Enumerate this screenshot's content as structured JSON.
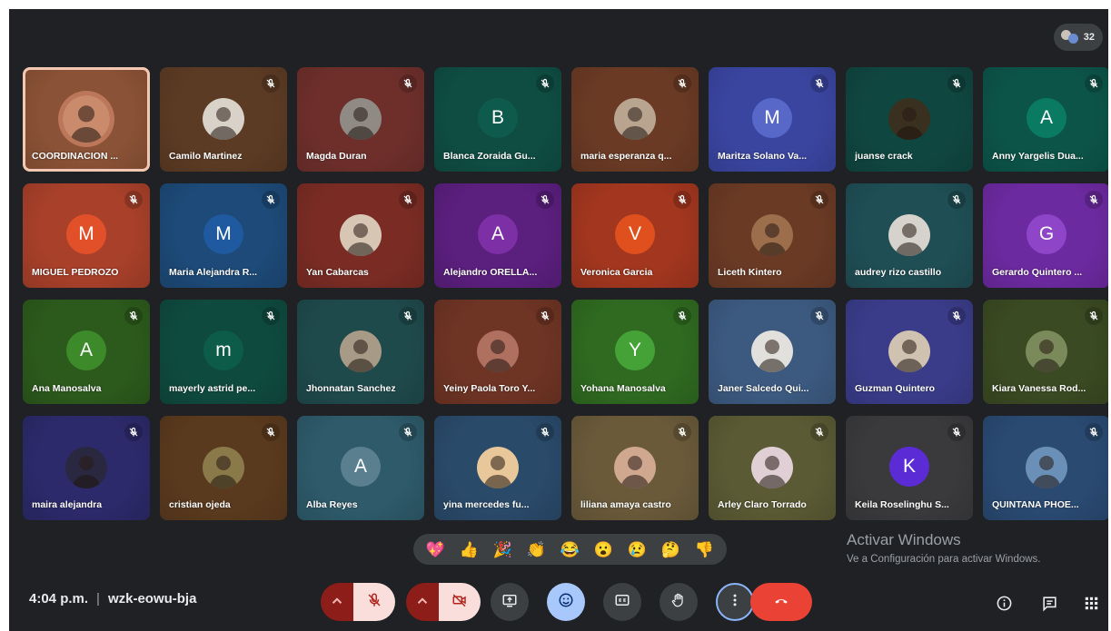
{
  "participants_count": "32",
  "participants": [
    {
      "name": "COORDINACION ...",
      "bg": "#8a5236",
      "type": "photo",
      "photo": "#c98b6b",
      "active": true,
      "mic": "none"
    },
    {
      "name": "Camilo Martinez",
      "bg": "#5c3b24",
      "type": "photo",
      "photo": "#d9d2c8",
      "mic": "#8d3b1c"
    },
    {
      "name": "Magda Duran",
      "bg": "#6e2f2b",
      "type": "photo",
      "photo": "#8f8a84",
      "mic": "#a52a2a"
    },
    {
      "name": "Blanca Zoraida Gu...",
      "bg": "#0f4d43",
      "type": "letter",
      "letter": "B",
      "circle": "#0e5a4c",
      "mic": "#0f4d43"
    },
    {
      "name": "maria esperanza q...",
      "bg": "#6a3a24",
      "type": "photo",
      "photo": "#b9a490",
      "mic": "#8d3b1c"
    },
    {
      "name": "Maritza Solano Va...",
      "bg": "#3a45a0",
      "type": "letter",
      "letter": "M",
      "circle": "#5768c8",
      "mic": "#2b3a9a"
    },
    {
      "name": "juanse crack",
      "bg": "#104640",
      "type": "photo",
      "photo": "#3a3020",
      "mic": "#104640"
    },
    {
      "name": "Anny Yargelis Dua...",
      "bg": "#0c5448",
      "type": "letter",
      "letter": "A",
      "circle": "#0b7a63",
      "mic": "#0c5448"
    },
    {
      "name": "MIGUEL PEDROZO",
      "bg": "#a8402a",
      "type": "letter",
      "letter": "M",
      "circle": "#e2502a",
      "mic": "#a83a26"
    },
    {
      "name": "Maria Alejandra R...",
      "bg": "#1d4a78",
      "type": "letter",
      "letter": "M",
      "circle": "#1f5aa0",
      "mic": "#1d4a78"
    },
    {
      "name": "Yan Cabarcas",
      "bg": "#7a2c24",
      "type": "photo",
      "photo": "#d8c6b4",
      "mic": "#a52a2a"
    },
    {
      "name": "Alejandro ORELLA...",
      "bg": "#5b1f7e",
      "type": "letter",
      "letter": "A",
      "circle": "#7d2fa6",
      "mic": "#5b1f7e"
    },
    {
      "name": "Veronica Garcia",
      "bg": "#a2361f",
      "type": "letter",
      "letter": "V",
      "circle": "#e0501e",
      "mic": "#a2361f"
    },
    {
      "name": "Liceth Kintero",
      "bg": "#6a3a24",
      "type": "photo",
      "photo": "#9d6e4c",
      "mic": "#8d4a24"
    },
    {
      "name": "audrey rizo castillo",
      "bg": "#1f4e55",
      "type": "photo",
      "photo": "#d6d2cc",
      "mic": "#1f4e55"
    },
    {
      "name": "Gerardo Quintero ...",
      "bg": "#6c2aa0",
      "type": "letter",
      "letter": "G",
      "circle": "#8f45c8",
      "mic": "#6c2aa0"
    },
    {
      "name": "Ana Manosalva",
      "bg": "#2c5a1c",
      "type": "letter",
      "letter": "A",
      "circle": "#3c8a2a",
      "mic": "#2c5a1c"
    },
    {
      "name": "mayerly astrid pe...",
      "bg": "#0f4a3e",
      "type": "letter",
      "letter": "m",
      "circle": "#0d5c4a",
      "mic": "#0f4a3e"
    },
    {
      "name": "Jhonnatan Sanchez",
      "bg": "#1f4a4c",
      "type": "photo",
      "photo": "#a79a86",
      "mic": "#1f4a4c"
    },
    {
      "name": "Yeiny Paola Toro Y...",
      "bg": "#6e3424",
      "type": "photo",
      "photo": "#b07060",
      "mic": "#8d3b1c"
    },
    {
      "name": "Yohana Manosalva",
      "bg": "#2f6a20",
      "type": "letter",
      "letter": "Y",
      "circle": "#44a236",
      "mic": "#2f6a20"
    },
    {
      "name": "Janer Salcedo Qui...",
      "bg": "#3c5a80",
      "type": "photo",
      "photo": "#e2e0dc",
      "mic": "#1f3a6a"
    },
    {
      "name": "Guzman Quintero",
      "bg": "#3a3c8a",
      "type": "photo",
      "photo": "#cfc2b0",
      "mic": "#2b2e80"
    },
    {
      "name": "Kiara Vanessa Rod...",
      "bg": "#3a4a22",
      "type": "photo",
      "photo": "#7a8a5a",
      "mic": "#3a4a22"
    },
    {
      "name": "maira alejandra",
      "bg": "#2c2a6a",
      "type": "photo",
      "photo": "#2a2840",
      "mic": "#2c2a6a"
    },
    {
      "name": "cristian ojeda",
      "bg": "#5a3a1e",
      "type": "photo",
      "photo": "#8a7a4a",
      "mic": "#7a4a22"
    },
    {
      "name": "Alba Reyes",
      "bg": "#2e5a6a",
      "type": "letter",
      "letter": "A",
      "circle": "#5a7f8e",
      "mic": "#1f4a6a"
    },
    {
      "name": "yina mercedes fu...",
      "bg": "#2a4a6a",
      "type": "photo",
      "photo": "#e8c89a",
      "mic": "#1f3a6a"
    },
    {
      "name": "liliana amaya castro",
      "bg": "#6a5a3a",
      "type": "photo",
      "photo": "#d0a890",
      "mic": "#6a4a22"
    },
    {
      "name": "Arley Claro Torrado",
      "bg": "#5a5a34",
      "type": "photo",
      "photo": "#e0d0d6",
      "mic": "#4a5a24"
    },
    {
      "name": "Keila Roselinghu S...",
      "bg": "#3a3a3c",
      "type": "letter",
      "letter": "K",
      "circle": "#5b2bd6",
      "mic": "#505050"
    },
    {
      "name": "QUINTANA PHOE...",
      "bg": "#2a4a72",
      "type": "photo",
      "photo": "#6a90b8",
      "mic": "#1f3a6a"
    }
  ],
  "reactions": [
    "💖",
    "👍",
    "🎉",
    "👏",
    "😂",
    "😮",
    "😢",
    "🤔",
    "👎"
  ],
  "watermark": {
    "title": "Activar Windows",
    "subtitle": "Ve a Configuración para activar Windows."
  },
  "meeting": {
    "time": "4:04 p.m.",
    "separator": "|",
    "code": "wzk-eowu-bja"
  },
  "colors": {
    "accent": "#8ab4f8",
    "danger": "#ea4335",
    "mic_off_bg": "#f9dedc"
  }
}
